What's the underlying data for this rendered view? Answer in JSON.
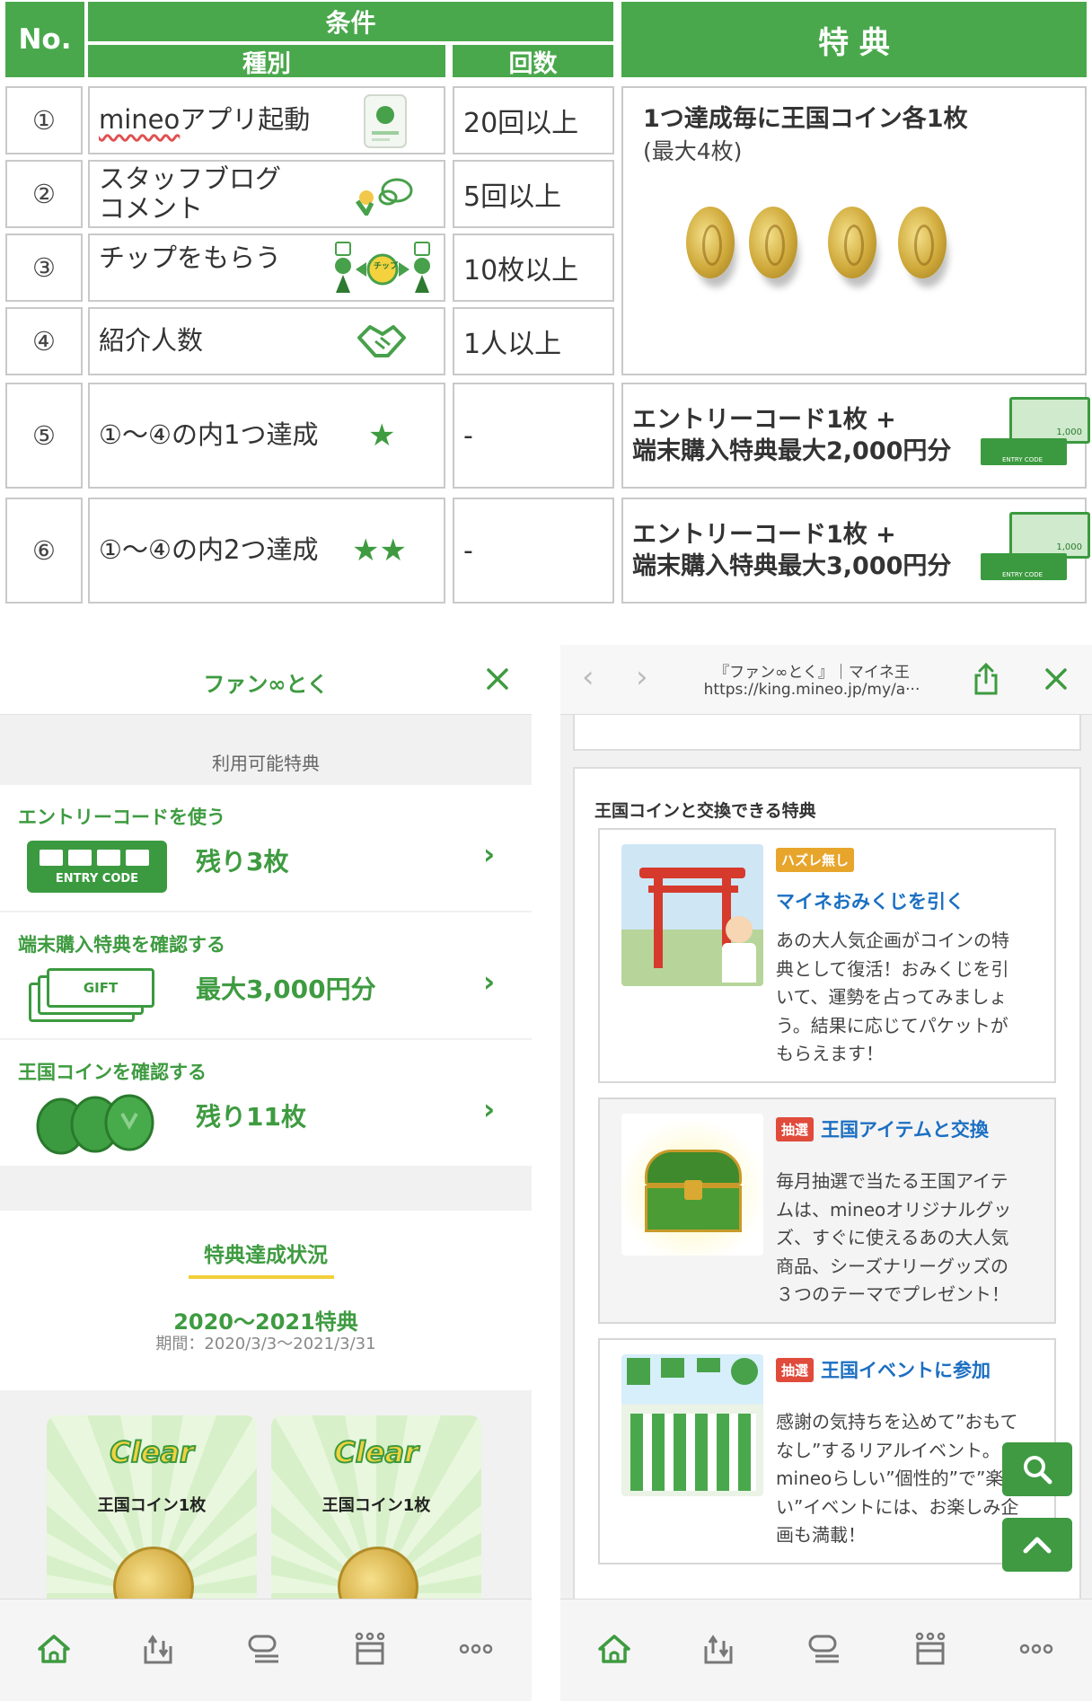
{
  "table": {
    "header_no": "No.",
    "header_condition": "条件",
    "header_type": "種別",
    "header_count": "回数",
    "header_benefit": "特 典",
    "rows": [
      {
        "no": "①",
        "type_brand": "mineo",
        "type_rest": "アプリ起動",
        "count": "20回以上"
      },
      {
        "no": "②",
        "type_line1": "スタッフブログ",
        "type_line2": "コメント",
        "count": "5回以上"
      },
      {
        "no": "③",
        "type": "チップをもらう",
        "count": "10枚以上",
        "chip_label": "チップ"
      },
      {
        "no": "④",
        "type": "紹介人数",
        "count": "1人以上"
      },
      {
        "no": "⑤",
        "type": "①〜④の内1つ達成",
        "count": "-",
        "stars": "★"
      },
      {
        "no": "⑥",
        "type": "①〜④の内2つ達成",
        "count": "-",
        "stars": "★★"
      }
    ],
    "coin_benefit_title": "1つ達成毎に王国コイン各1枚",
    "coin_benefit_sub": "(最大4枚)",
    "entry5_line1": "エントリーコード1枚 +",
    "entry5_line2": "端末購入特典最大2,000円分",
    "entry6_line1": "エントリーコード1枚 +",
    "entry6_line2": "端末購入特典最大3,000円分",
    "ticket_value": "1,000",
    "ticket_code": "ENTRY CODE"
  },
  "left": {
    "title": "ファン∞とく",
    "section_available": "利用可能特典",
    "rows": [
      {
        "label": "エントリーコードを使う",
        "value": "残り3枚",
        "icon_text": "ENTRY CODE"
      },
      {
        "label": "端末購入特典を確認する",
        "value": "最大3,000円分",
        "icon_text": "GIFT"
      },
      {
        "label": "王国コインを確認する",
        "value": "残り11枚"
      }
    ],
    "status_title": "特典達成状況",
    "period_title": "2020〜2021特典",
    "period_text": "期間：2020/3/3〜2021/3/31",
    "clear_cards": [
      {
        "clear": "Clear",
        "reward": "王国コイン1枚"
      },
      {
        "clear": "Clear",
        "reward": "王国コイン1枚"
      }
    ]
  },
  "right": {
    "browser_title": "『ファン∞とく』｜マイネ王",
    "browser_url": "https://king.mineo.jp/my/a···",
    "section_title": "王国コインと交換できる特典",
    "cards": [
      {
        "badge": "ハズレ無し",
        "title": "マイネおみくじを引く",
        "desc": [
          "あの大人気企画がコインの特",
          "典として復活！おみくじを引",
          "いて、運勢を占ってみましょ",
          "う。結果に応じてパケットが",
          "もらえます！"
        ]
      },
      {
        "badge": "抽選",
        "title": "王国アイテムと交換",
        "desc": [
          "毎月抽選で当たる王国アイテ",
          "ムは、mineoオリジナルグッ",
          "ズ、すぐに使えるあの大人気",
          "商品、シーズナリーグッズの",
          "３つのテーマでプレゼント！"
        ]
      },
      {
        "badge": "抽選",
        "title": "王国イベントに参加",
        "desc": [
          "感謝の気持ちを込めて”おもて",
          "なし”するリアルイベント。",
          "mineoらしい”個性的”で”楽し",
          "い”イベントには、お楽しみ企",
          "画も満載！"
        ]
      }
    ]
  },
  "colors": {
    "green": "#4aa84c",
    "text_green": "#3e9b40",
    "link_blue": "#1b6fc2",
    "badge_orange": "#e7a52b",
    "badge_red": "#e04b3c"
  }
}
